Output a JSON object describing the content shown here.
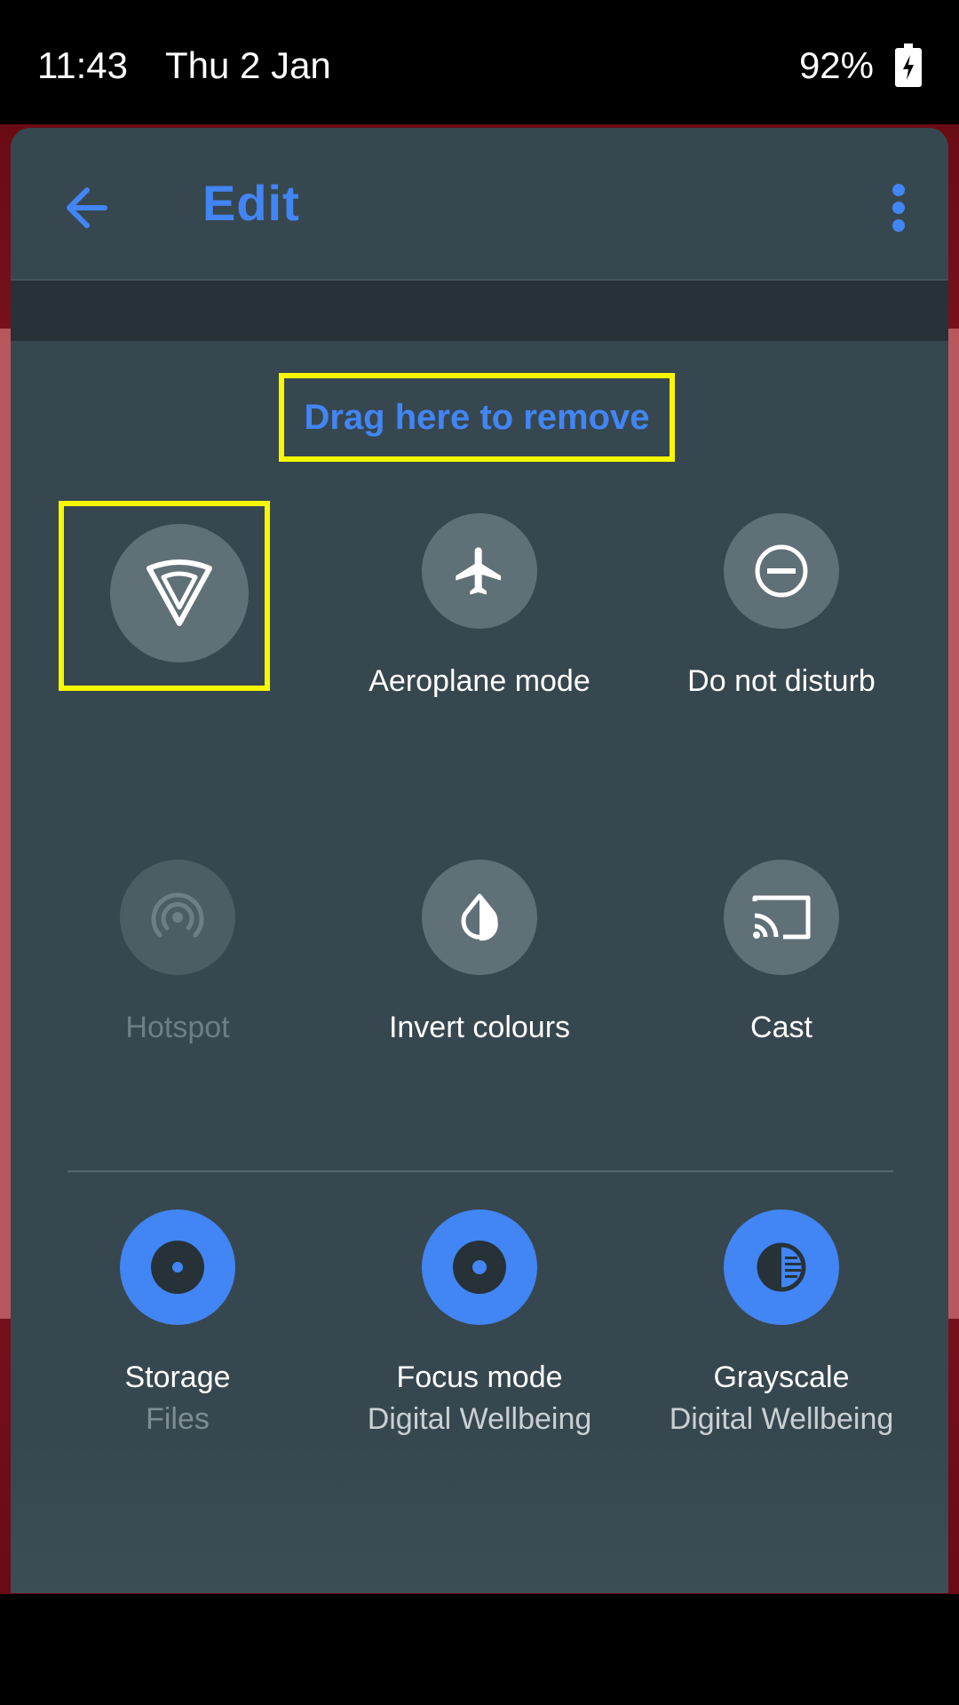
{
  "status_bar": {
    "time": "11:43",
    "date": "Thu 2 Jan",
    "battery": "92%"
  },
  "toolbar": {
    "title": "Edit",
    "back_icon": "arrow-back-icon",
    "more_icon": "more-vert-icon"
  },
  "remove_zone": {
    "label": "Drag here to remove"
  },
  "tiles_active": [
    {
      "icon": "vpn-shield-icon",
      "label": ""
    },
    {
      "icon": "airplane-icon",
      "label": "Aeroplane mode"
    },
    {
      "icon": "do-not-disturb-icon",
      "label": "Do not disturb"
    },
    {
      "icon": "hotspot-icon",
      "label": "Hotspot"
    },
    {
      "icon": "invert-colours-icon",
      "label": "Invert colours"
    },
    {
      "icon": "cast-icon",
      "label": "Cast"
    }
  ],
  "tiles_available": [
    {
      "icon": "storage-icon",
      "label": "Storage",
      "sub": "Files"
    },
    {
      "icon": "focus-mode-icon",
      "label": "Focus mode",
      "sub": "Digital Wellbeing"
    },
    {
      "icon": "grayscale-icon",
      "label": "Grayscale",
      "sub": "Digital Wellbeing"
    }
  ],
  "colors": {
    "accent": "#4285f4",
    "panel": "#37474f",
    "highlight": "#f8f800"
  }
}
